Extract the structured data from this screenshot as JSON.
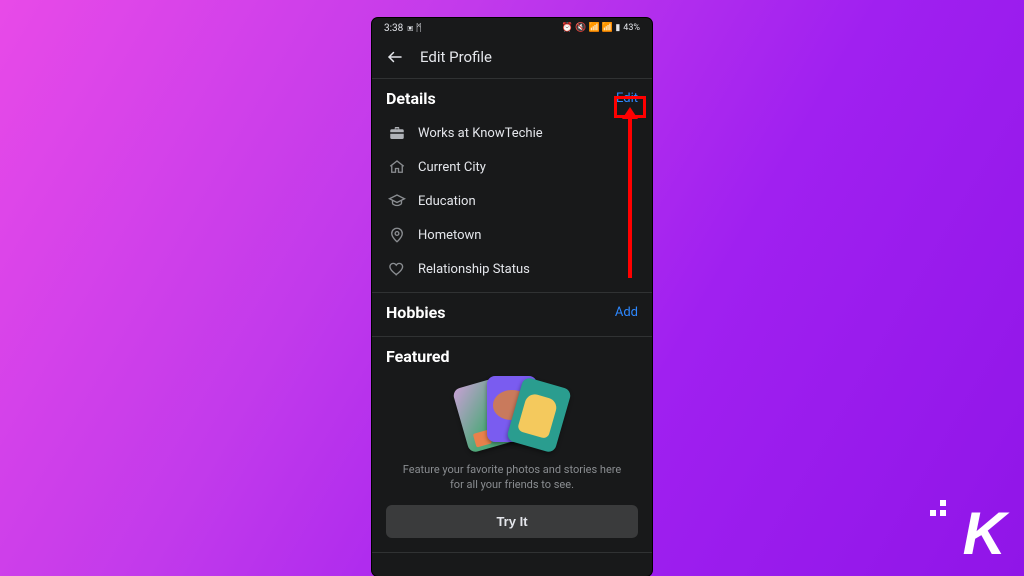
{
  "status": {
    "time": "3:38",
    "left_icons": "▣ ᛗ",
    "right_text": "43%",
    "right_icons": "⏰ 🔇 📶 📶 ▮"
  },
  "header": {
    "title": "Edit Profile"
  },
  "sections": {
    "details": {
      "title": "Details",
      "action": "Edit",
      "items": [
        {
          "icon": "briefcase",
          "label": "Works at KnowTechie"
        },
        {
          "icon": "home",
          "label": "Current City"
        },
        {
          "icon": "gradcap",
          "label": "Education"
        },
        {
          "icon": "pin",
          "label": "Hometown"
        },
        {
          "icon": "heart",
          "label": "Relationship Status"
        }
      ]
    },
    "hobbies": {
      "title": "Hobbies",
      "action": "Add"
    },
    "featured": {
      "title": "Featured",
      "description": "Feature your favorite photos and stories here for all your friends to see.",
      "button": "Try It"
    }
  },
  "annotation": {
    "highlight": "details-edit-action"
  },
  "branding": {
    "logo_letter": "K"
  }
}
